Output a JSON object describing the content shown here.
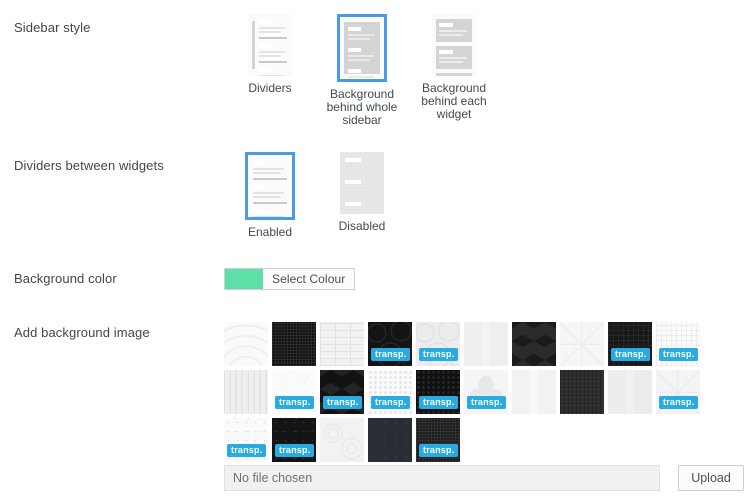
{
  "rows": {
    "sidebar_style": {
      "label": "Sidebar style",
      "options": [
        {
          "id": "dividers",
          "caption": "Dividers",
          "selected": false,
          "thumb": "dividers"
        },
        {
          "id": "bg-whole-sidebar",
          "caption": "Background behind whole sidebar",
          "selected": true,
          "thumb": "panel"
        },
        {
          "id": "bg-each-widget",
          "caption": "Background behind each widget",
          "selected": false,
          "thumb": "widgets"
        }
      ]
    },
    "dividers_between_widgets": {
      "label": "Dividers between widgets",
      "options": [
        {
          "id": "enabled",
          "caption": "Enabled",
          "selected": true,
          "thumb": "dividers-plain"
        },
        {
          "id": "disabled",
          "caption": "Disabled",
          "selected": false,
          "thumb": "no-dividers"
        }
      ]
    },
    "background_color": {
      "label": "Background color",
      "button_label": "Select Colour",
      "swatch_hex": "#5ddfa7"
    },
    "background_image": {
      "label": "Add background image",
      "transparent_tag": "transp.",
      "tag_color": "#29abe2",
      "file_placeholder": "No file chosen",
      "upload_label": "Upload",
      "patterns": [
        {
          "id": "p1",
          "kind": "arcs-light",
          "base": "#fafafa",
          "ink": "#eeeeee",
          "transparent": false
        },
        {
          "id": "p2",
          "kind": "noise-dark",
          "base": "#111111",
          "ink": "#2a2a2a",
          "transparent": false
        },
        {
          "id": "p3",
          "kind": "brick-light",
          "base": "#f2f2f2",
          "ink": "#e2e2e2",
          "transparent": false
        },
        {
          "id": "p4",
          "kind": "polygon-dark",
          "base": "#141414",
          "ink": "#2e2e2e",
          "transparent": true
        },
        {
          "id": "p5",
          "kind": "polygon-light",
          "base": "#ececec",
          "ink": "#dcdcdc",
          "transparent": true
        },
        {
          "id": "p6",
          "kind": "plain-light",
          "base": "#f3f3f3",
          "ink": "#ebebeb",
          "transparent": false
        },
        {
          "id": "p7",
          "kind": "cube-dark",
          "base": "#2b2b2b",
          "ink": "#1b1b1b",
          "transparent": false
        },
        {
          "id": "p8",
          "kind": "starburst-light",
          "base": "#f6f6f6",
          "ink": "#e8e8e8",
          "transparent": false
        },
        {
          "id": "p9",
          "kind": "grid-dark",
          "base": "#181818",
          "ink": "#262626",
          "transparent": true
        },
        {
          "id": "p10",
          "kind": "grid-light",
          "base": "#fbfbfb",
          "ink": "#ededed",
          "transparent": true
        },
        {
          "id": "p11",
          "kind": "wood-light",
          "base": "#f0f0f0",
          "ink": "#e0e0e0",
          "transparent": false
        },
        {
          "id": "p12",
          "kind": "hex-light",
          "base": "#fbfbfb",
          "ink": "#f0f0f0",
          "transparent": true
        },
        {
          "id": "p13",
          "kind": "cube-dark2",
          "base": "#121212",
          "ink": "#242424",
          "transparent": true
        },
        {
          "id": "p14",
          "kind": "halftone-light",
          "base": "#fafafa",
          "ink": "#e6e6e6",
          "transparent": true
        },
        {
          "id": "p15",
          "kind": "halftone-dark",
          "base": "#101010",
          "ink": "#262626",
          "transparent": true
        },
        {
          "id": "p16",
          "kind": "fleur-light",
          "base": "#f5f5f5",
          "ink": "#e8e8e8",
          "transparent": true
        },
        {
          "id": "p17",
          "kind": "paper-light",
          "base": "#f7f7f7",
          "ink": "#ededed",
          "transparent": false
        },
        {
          "id": "p18",
          "kind": "fabric-dark",
          "base": "#2d2d2d",
          "ink": "#232323",
          "transparent": false
        },
        {
          "id": "p19",
          "kind": "plain-light2",
          "base": "#f1f1f1",
          "ink": "#e9e9e9",
          "transparent": false
        },
        {
          "id": "p20",
          "kind": "lowpoly-light",
          "base": "#f4f4f4",
          "ink": "#e6e6e6",
          "transparent": true
        },
        {
          "id": "p21",
          "kind": "speckle-light",
          "base": "#fafafa",
          "ink": "#e4e4e4",
          "transparent": true
        },
        {
          "id": "p22",
          "kind": "speckle-dark",
          "base": "#141414",
          "ink": "#2c2c2c",
          "transparent": true
        },
        {
          "id": "p23",
          "kind": "swirl-light",
          "base": "#f2f2f2",
          "ink": "#e6e6e6",
          "transparent": false
        },
        {
          "id": "p24",
          "kind": "stars-dark",
          "base": "#2a2d33",
          "ink": "#3a3d44",
          "transparent": false
        },
        {
          "id": "p25",
          "kind": "noise-dark2",
          "base": "#1c1c1c",
          "ink": "#303030",
          "transparent": true
        }
      ]
    }
  }
}
